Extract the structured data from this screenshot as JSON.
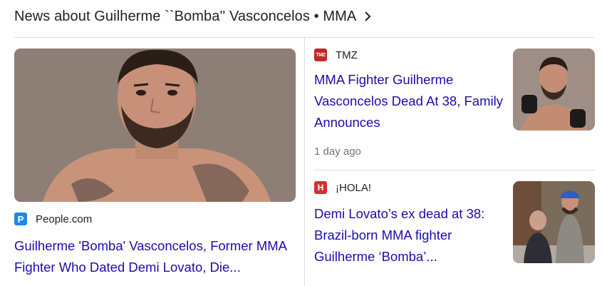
{
  "header": {
    "title": "News about Guilherme ``Bomba'' Vasconcelos • MMA"
  },
  "featured": {
    "source": "People.com",
    "source_icon": "P",
    "source_icon_color": "#1e88e5",
    "title": "Guilherme 'Bomba' Vasconcelos, Former MMA Fighter Who Dated Demi Lovato, Die..."
  },
  "articles": [
    {
      "source": "TMZ",
      "source_icon": "TMZ",
      "source_icon_color": "#c62828",
      "title": "MMA Fighter Guilherme Vasconcelos Dead At 38, Family Announces",
      "time": "1 day ago"
    },
    {
      "source": "¡HOLA!",
      "source_icon": "H",
      "source_icon_color": "#d32f2f",
      "title": "Demi Lovato’s ex dead at 38: Brazil-born MMA fighter Guilherme ‘Bomba’..."
    }
  ],
  "colors": {
    "link": "#1a0dab",
    "divider": "#dadce0",
    "meta": "#70757a"
  }
}
